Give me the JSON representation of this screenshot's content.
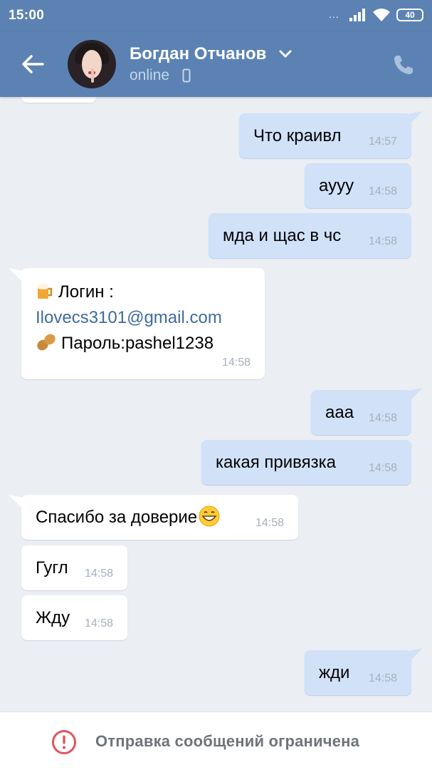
{
  "status_bar": {
    "time": "15:00",
    "dots": "...",
    "battery": "40"
  },
  "header": {
    "contact_name": "Богдан Отчанов",
    "status": "online",
    "icons": [
      "back-arrow-icon",
      "chevron-down-icon",
      "mobile-device-icon",
      "phone-icon"
    ]
  },
  "messages": [
    {
      "dir": "out",
      "text": "Что краивл",
      "time": "14:57"
    },
    {
      "dir": "out",
      "text": "аууу",
      "time": "14:58"
    },
    {
      "dir": "out",
      "text": "мда и щас в чс",
      "time": "14:58"
    },
    {
      "dir": "in",
      "lines": [
        "Логин :",
        "Ilovecs3101@gmail.com",
        "Пароль:pashel1238"
      ],
      "time": "14:58"
    },
    {
      "dir": "out",
      "text": "ааа",
      "time": "14:58"
    },
    {
      "dir": "out",
      "text": "какая привязка",
      "time": "14:58"
    },
    {
      "dir": "in",
      "text": "Спасибо за доверие",
      "time": "14:58"
    },
    {
      "dir": "in",
      "text": "Гугл",
      "time": "14:58"
    },
    {
      "dir": "in",
      "text": "Жду",
      "time": "14:58"
    },
    {
      "dir": "out",
      "text": "жди",
      "time": "14:58"
    }
  ],
  "bottom_bar": {
    "text": "Отправка сообщений ограничена",
    "icon": "warning-circle-icon"
  },
  "colors": {
    "header_bg": "#5b82b3",
    "outgoing_bubble": "#d0e1f8",
    "incoming_bubble": "#ffffff",
    "chat_bg": "#ebeef3",
    "warning_red": "#e0545a",
    "link": "#3f6b9e"
  }
}
